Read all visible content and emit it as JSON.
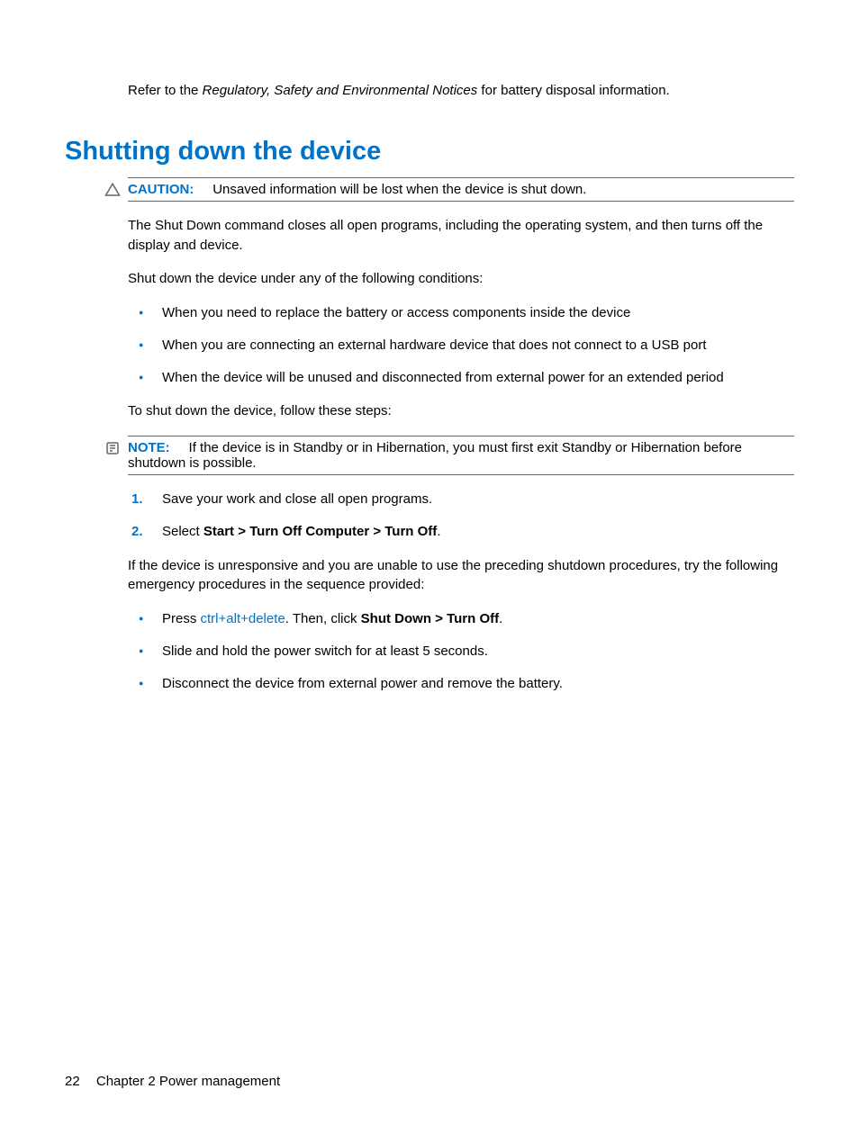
{
  "intro": {
    "prefix": "Refer to the ",
    "italic": "Regulatory, Safety and Environmental Notices",
    "suffix": " for battery disposal information."
  },
  "heading": "Shutting down the device",
  "caution": {
    "label": "CAUTION:",
    "text": "Unsaved information will be lost when the device is shut down."
  },
  "p1": "The Shut Down command closes all open programs, including the operating system, and then turns off the display and device.",
  "p2": "Shut down the device under any of the following conditions:",
  "conditions": [
    "When you need to replace the battery or access components inside the device",
    "When you are connecting an external hardware device that does not connect to a USB port",
    "When the device will be unused and disconnected from external power for an extended period"
  ],
  "p3": "To shut down the device, follow these steps:",
  "note": {
    "label": "NOTE:",
    "text": "If the device is in Standby or in Hibernation, you must first exit Standby or Hibernation before shutdown is possible."
  },
  "steps": [
    {
      "num": "1.",
      "text": "Save your work and close all open programs."
    },
    {
      "num": "2.",
      "prefix": "Select ",
      "bold": "Start > Turn Off Computer > Turn Off",
      "suffix": "."
    }
  ],
  "p4": "If the device is unresponsive and you are unable to use the preceding shutdown procedures, try the following emergency procedures in the sequence provided:",
  "emergency": [
    {
      "pre": "Press ",
      "link": "ctrl+alt+delete",
      "mid": ". Then, click ",
      "bold": "Shut Down > Turn Off",
      "post": "."
    },
    {
      "text": "Slide and hold the power switch for at least 5 seconds."
    },
    {
      "text": "Disconnect the device from external power and remove the battery."
    }
  ],
  "footer": {
    "page": "22",
    "chapter": "Chapter 2   Power management"
  }
}
